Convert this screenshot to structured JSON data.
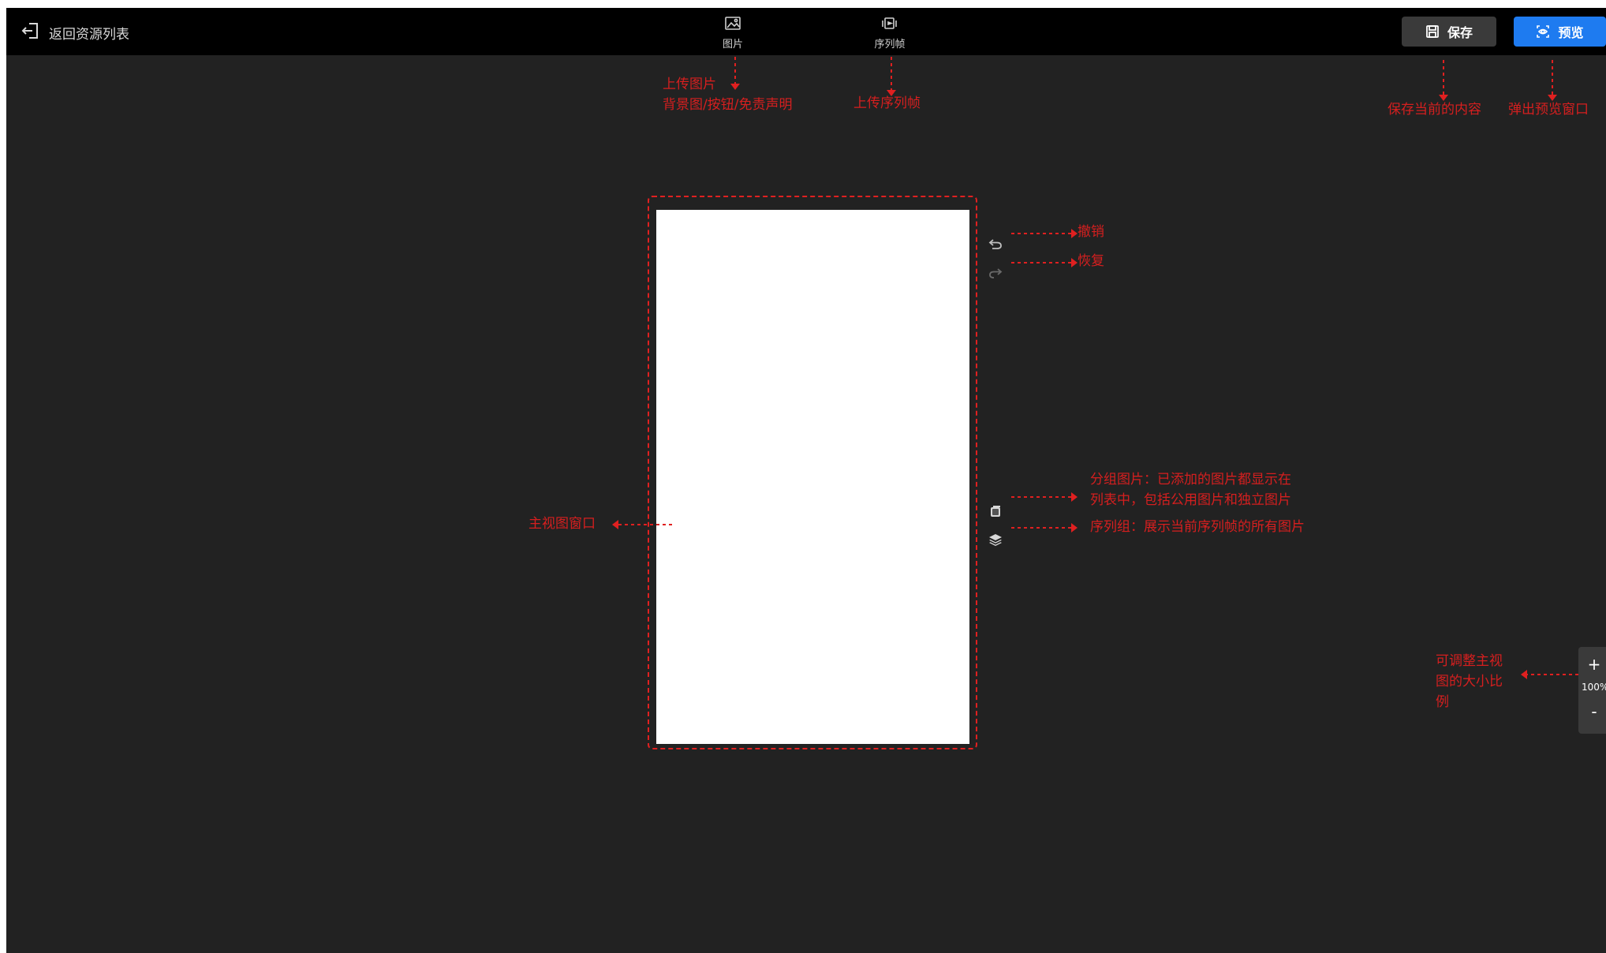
{
  "topbar": {
    "back_label": "返回资源列表",
    "image_tool_label": "图片",
    "sequence_tool_label": "序列帧",
    "save_label": "保存",
    "preview_label": "预览"
  },
  "annotations": {
    "upload_image": "上传图片",
    "upload_image_sub": "背景图/按钮/免责声明",
    "upload_sequence": "上传序列帧",
    "save_desc": "保存当前的内容",
    "preview_desc": "弹出预览窗口",
    "undo": "撤销",
    "redo": "恢复",
    "group_images_line1": "分组图片：已添加的图片都显示在",
    "group_images_line2": "列表中，包括公用图片和独立图片",
    "sequence_group": "序列组：展示当前序列帧的所有图片",
    "main_view": "主视图窗口",
    "zoom_line1": "可调整主视",
    "zoom_line2": "图的大小比",
    "zoom_line3": "例"
  },
  "zoom": {
    "plus": "+",
    "value": "100%",
    "minus": "-"
  },
  "colors": {
    "background": "#222222",
    "topbar": "#000000",
    "accent_blue": "#1e7bf0",
    "annotation_red": "#d61f1f",
    "canvas": "#ffffff"
  }
}
